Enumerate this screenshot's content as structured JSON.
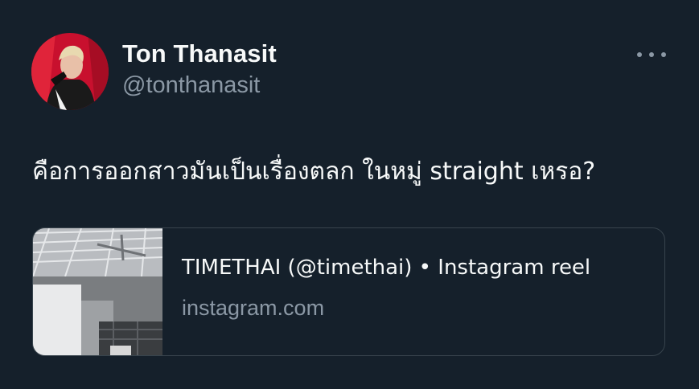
{
  "author": {
    "display_name": "Ton Thanasit",
    "handle": "@tonthanasit"
  },
  "tweet": {
    "text": "คือการออกสาวมันเป็นเรื่องตลก ในหมู่ straight เหรอ?"
  },
  "link_card": {
    "title": "TIMETHAI (@timethai) • Instagram reel",
    "domain": "instagram.com"
  },
  "icons": {
    "more": "more-horizontal-icon"
  },
  "colors": {
    "background": "#15202b",
    "primary_text": "#f7f9f9",
    "secondary_text": "#8b98a5",
    "card_border": "#38444d"
  }
}
